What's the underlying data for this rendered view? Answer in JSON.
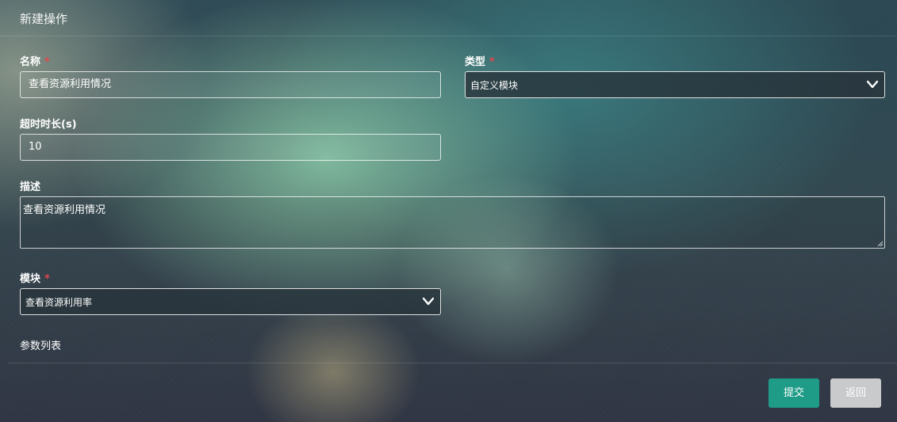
{
  "header": {
    "title": "新建操作"
  },
  "form": {
    "name": {
      "label": "名称",
      "required_mark": "*",
      "value": "查看资源利用情况"
    },
    "type": {
      "label": "类型",
      "required_mark": "*",
      "selected": "自定义模块",
      "icon": "chevron-down-icon"
    },
    "timeout": {
      "label": "超时时长(s)",
      "value": "10"
    },
    "description": {
      "label": "描述",
      "value": "查看资源利用情况"
    },
    "module": {
      "label": "模块",
      "required_mark": "*",
      "selected": "查看资源利用率",
      "icon": "chevron-down-icon"
    },
    "params": {
      "label": "参数列表"
    }
  },
  "actions": {
    "submit_label": "提交",
    "back_label": "返回"
  },
  "colors": {
    "required": "#e0474c",
    "submit": "#1f9c88",
    "back": "#c9cacb"
  }
}
